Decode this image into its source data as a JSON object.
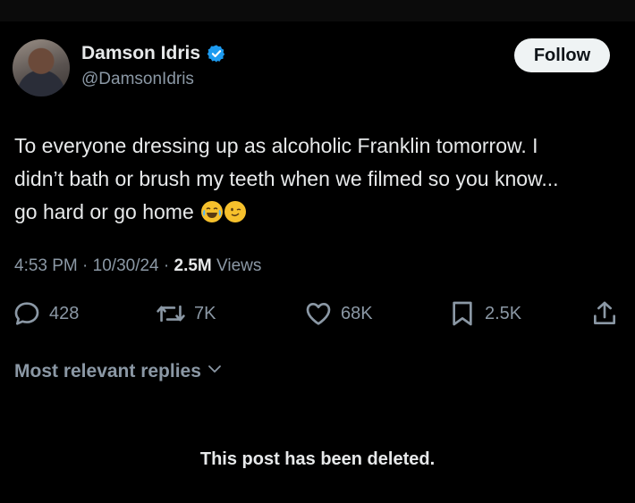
{
  "author": {
    "name": "Damson Idris",
    "handle": "@DamsonIdris",
    "follow_label": "Follow"
  },
  "post": {
    "text_lines": [
      "To everyone dressing up as alcoholic Franklin tomorrow. I",
      "didn’t bath or brush my teeth when we filmed so you know...",
      "go hard or go home"
    ],
    "emojis": [
      "face-with-tears-of-joy",
      "winking-face"
    ],
    "time": "4:53 PM",
    "date": "10/30/24",
    "separator": "·",
    "views_count": "2.5M",
    "views_label": "Views"
  },
  "actions": {
    "replies": "428",
    "reposts": "7K",
    "likes": "68K",
    "bookmarks": "2.5K"
  },
  "replies_section": {
    "sort_label": "Most relevant replies",
    "deleted_message": "This post has been deleted."
  },
  "colors": {
    "background": "#000000",
    "text": "#e7e9ea",
    "muted": "#8b98a5",
    "verified": "#1d9bf0",
    "follow_bg": "#eff3f4"
  }
}
